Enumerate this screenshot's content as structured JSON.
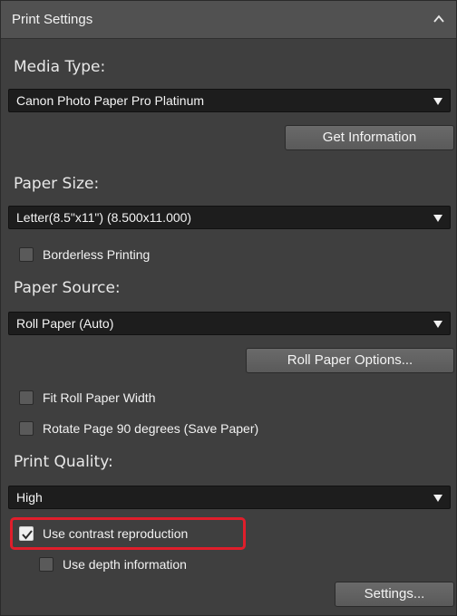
{
  "header": {
    "title": "Print Settings",
    "collapse_icon": "chevron-up-icon"
  },
  "media_type": {
    "label": "Media Type:",
    "value": "Canon Photo Paper Pro Platinum",
    "button": "Get Information"
  },
  "paper_size": {
    "label": "Paper Size:",
    "value": "Letter(8.5\"x11\") (8.500x11.000)",
    "borderless": "Borderless Printing"
  },
  "paper_source": {
    "label": "Paper Source:",
    "value": "Roll Paper (Auto)",
    "button": "Roll Paper Options...",
    "fit_width": "Fit Roll Paper Width",
    "rotate": "Rotate Page 90 degrees (Save Paper)"
  },
  "print_quality": {
    "label": "Print Quality:",
    "value": "High",
    "contrast": "Use contrast reproduction",
    "contrast_checked": true,
    "depth": "Use depth information",
    "settings_button": "Settings..."
  },
  "colors": {
    "highlight": "#e01e2b",
    "panel": "#3f3f3f"
  }
}
